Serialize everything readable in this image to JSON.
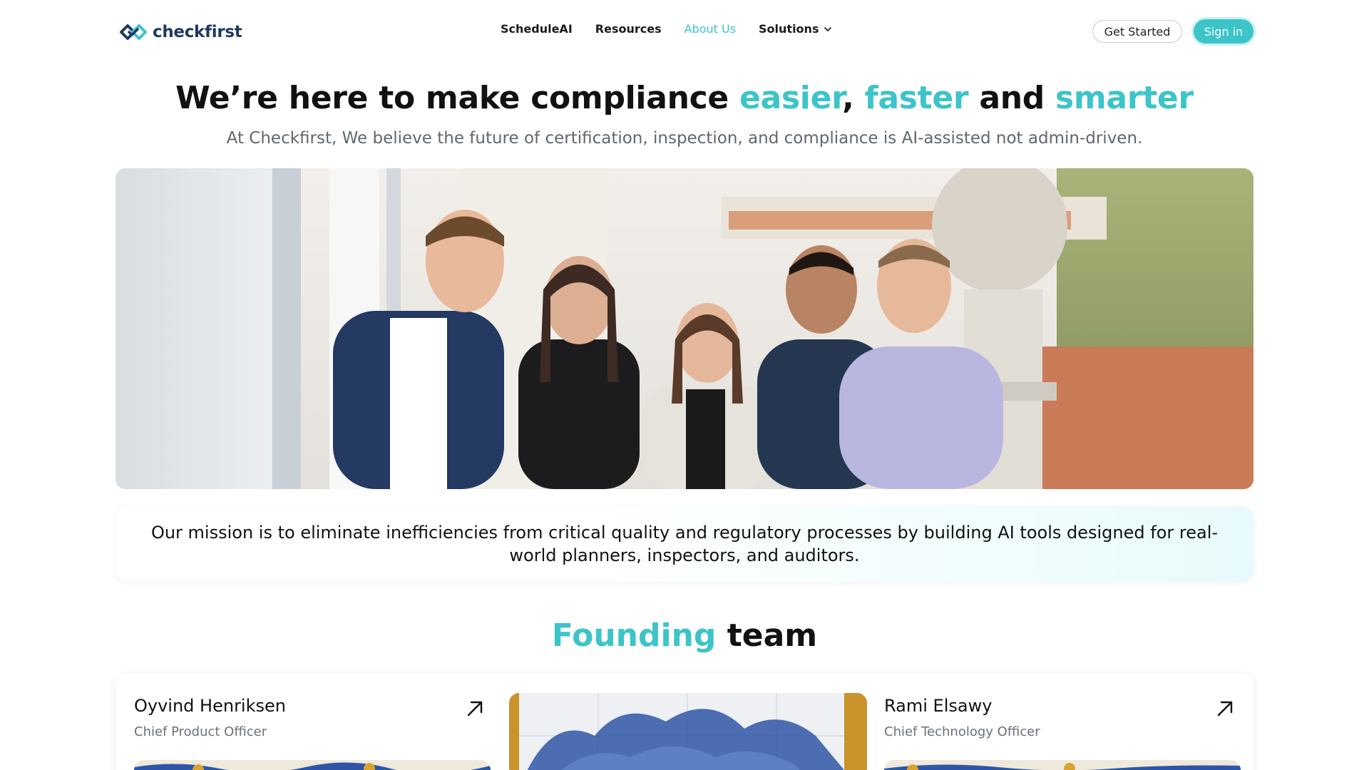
{
  "nav": {
    "logo_text": "checkfirst",
    "links": [
      {
        "label": "ScheduleAI"
      },
      {
        "label": "Resources"
      },
      {
        "label": "About Us"
      },
      {
        "label": "Solutions"
      }
    ],
    "get_started": "Get Started",
    "sign_in": "Sign in"
  },
  "hero": {
    "headline_part1": "We’re here to make compliance ",
    "headline_accent1": "easier",
    "headline_comma": ", ",
    "headline_accent2": "faster",
    "headline_and": " and ",
    "headline_accent3": "smarter",
    "subheadline": "At Checkfirst, We believe the future of certification, inspection, and compliance is AI-assisted not admin-driven."
  },
  "mission": {
    "text": "Our mission is to eliminate inefficiencies from critical quality and regulatory processes by building AI tools designed for real-world planners, inspectors, and auditors."
  },
  "team": {
    "title_accent": "Founding",
    "title_rest": " team",
    "members": [
      {
        "name": "Oyvind Henriksen",
        "role": "Chief Product Officer"
      },
      {
        "name": "Rami Elsawy",
        "role": "Chief Technology Officer"
      }
    ]
  },
  "colors": {
    "accent": "#3cc4c9",
    "text": "#111111",
    "muted": "#5f6770",
    "brand_dark": "#1e3a5f"
  }
}
